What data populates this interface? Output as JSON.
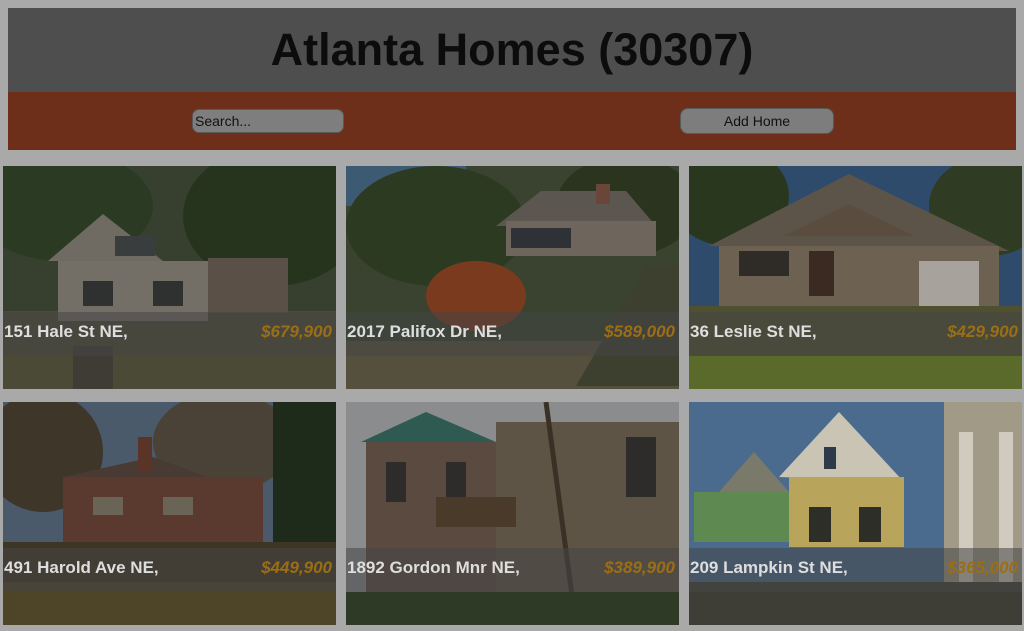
{
  "header": {
    "title": "Atlanta Homes (30307)"
  },
  "toolbar": {
    "search_placeholder": "Search...",
    "add_label": "Add Home"
  },
  "listings": [
    {
      "address": "151 Hale St NE,",
      "price": "$679,900"
    },
    {
      "address": "2017 Palifox Dr NE,",
      "price": "$589,000"
    },
    {
      "address": "36 Leslie St NE,",
      "price": "$429,900"
    },
    {
      "address": "491 Harold Ave NE,",
      "price": "$449,900"
    },
    {
      "address": "1892 Gordon Mnr NE,",
      "price": "$389,900"
    },
    {
      "address": "209 Lampkin St NE,",
      "price": "$365,000"
    }
  ],
  "colors": {
    "header_bg": "#4e4e4e",
    "toolbar_bg": "#6d2f1a",
    "price_text": "#9b6e15"
  }
}
